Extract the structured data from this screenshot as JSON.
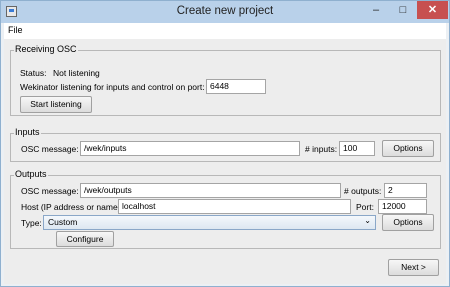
{
  "window": {
    "title": "Create new project",
    "minimize": "–",
    "maximize": "□",
    "close": "✕"
  },
  "menu": {
    "file": "File"
  },
  "receiving": {
    "legend": "Receiving OSC",
    "status_label": "Status:",
    "status_value": "Not listening",
    "port_label": "Wekinator listening for inputs and control on port:",
    "port_value": "6448",
    "start_button": "Start listening"
  },
  "inputs": {
    "legend": "Inputs",
    "osc_label": "OSC message:",
    "osc_value": "/wek/inputs",
    "count_label": "# inputs:",
    "count_value": "100",
    "options_button": "Options"
  },
  "outputs": {
    "legend": "Outputs",
    "osc_label": "OSC message:",
    "osc_value": "/wek/outputs",
    "count_label": "# outputs:",
    "count_value": "2",
    "host_label": "Host (IP address or name):",
    "host_value": "localhost",
    "port_label": "Port:",
    "port_value": "12000",
    "type_label": "Type:",
    "type_value": "Custom",
    "options_button": "Options",
    "configure_button": "Configure"
  },
  "next_button": "Next >"
}
